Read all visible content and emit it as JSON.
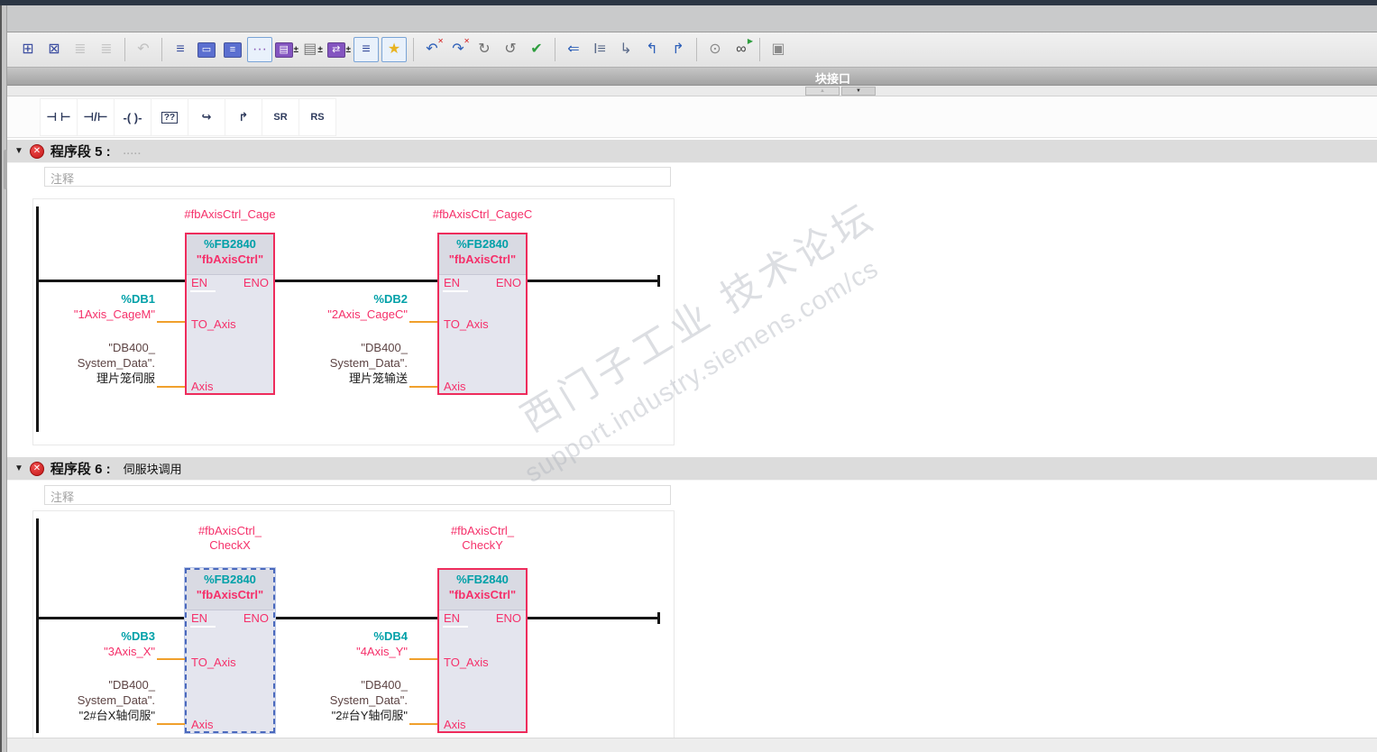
{
  "block_interface": {
    "title": "块接口",
    "collapse_up": "▲",
    "collapse_down": "▼"
  },
  "toolbar": {
    "icons": [
      {
        "name": "insert-network",
        "glyph": "⊞",
        "color": "#3b4da0"
      },
      {
        "name": "delete-network",
        "glyph": "⊠",
        "color": "#3b4da0"
      },
      {
        "name": "insert-row-above",
        "glyph": "≣",
        "color": "#9a9a9a",
        "disabled": true
      },
      {
        "name": "insert-row-below",
        "glyph": "≣",
        "color": "#9a9a9a",
        "disabled": true
      },
      {
        "sep": true
      },
      {
        "name": "keep-actual-values",
        "glyph": "↶",
        "color": "#8f8f8f",
        "disabled": true
      },
      {
        "sep": true
      },
      {
        "name": "absolute-symbolic-operands",
        "glyph": "≡",
        "color": "#3a4f9e"
      },
      {
        "name": "network-title-display",
        "glyph": "▭",
        "color": "#ffffff",
        "tile": "#5b6fd0"
      },
      {
        "name": "network-comment-display",
        "glyph": "≡",
        "color": "#ffffff",
        "tile": "#5b6fd0"
      },
      {
        "name": "toggle-comments",
        "glyph": "···",
        "color": "#8b5bb8",
        "active": true
      },
      {
        "name": "box-parameter-display",
        "glyph": "▤",
        "color": "#ffffff",
        "tile": "#8455c0",
        "dropdown": true
      },
      {
        "name": "hidden-parameter-display",
        "glyph": "▤",
        "color": "#777777",
        "dropdown": true
      },
      {
        "name": "symbol-information",
        "glyph": "⇄",
        "color": "#ffffff",
        "tile": "#8455c0",
        "dropdown": true
      },
      {
        "name": "display-format",
        "glyph": "≡",
        "color": "#3a4f9e",
        "active": true
      },
      {
        "name": "favorites-display",
        "glyph": "★",
        "color": "#e8b321",
        "active": true
      },
      {
        "sep": true
      },
      {
        "name": "previous-error",
        "glyph": "↶",
        "color": "#2d5fb8",
        "badge": "✕",
        "badge_color": "#d42020"
      },
      {
        "name": "next-error",
        "glyph": "↷",
        "color": "#2d5fb8",
        "badge": "✕",
        "badge_color": "#d42020"
      },
      {
        "name": "update-block-call",
        "glyph": "↻",
        "color": "#6f6f6f"
      },
      {
        "name": "update-interface",
        "glyph": "↺",
        "color": "#6f6f6f"
      },
      {
        "name": "consistency-check",
        "glyph": "✔",
        "color": "#2f9e3f"
      },
      {
        "sep": true
      },
      {
        "name": "call-structure",
        "glyph": "⇐",
        "color": "#2d5fb8"
      },
      {
        "name": "call-environment",
        "glyph": "I≡",
        "color": "#5b6b8a"
      },
      {
        "name": "assignment-list",
        "glyph": "↳",
        "color": "#5b6b8a"
      },
      {
        "name": "previous-marker",
        "glyph": "↰",
        "color": "#2d5fb8"
      },
      {
        "name": "next-marker",
        "glyph": "↱",
        "color": "#2d5fb8"
      },
      {
        "sep": true
      },
      {
        "name": "find-in-block",
        "glyph": "⊙",
        "color": "#8a8a8a"
      },
      {
        "name": "test-monitor",
        "glyph": "∞",
        "color": "#444444",
        "badge": "▶",
        "badge_color": "#2f9e3f"
      },
      {
        "sep": true
      },
      {
        "name": "data-block-values",
        "glyph": "▣",
        "color": "#8a8a8a"
      }
    ]
  },
  "favorites": {
    "items": [
      {
        "name": "contact-no",
        "glyph": "⊣ ⊢"
      },
      {
        "name": "contact-nc",
        "glyph": "⊣/⊢"
      },
      {
        "name": "coil",
        "glyph": "-( )-"
      },
      {
        "name": "empty-box",
        "glyph": "??",
        "boxed": true
      },
      {
        "name": "open-branch",
        "glyph": "↪"
      },
      {
        "name": "close-branch",
        "glyph": "↱"
      },
      {
        "name": "sr-flipflop",
        "glyph": "SR",
        "small": true
      },
      {
        "name": "rs-flipflop",
        "glyph": "RS",
        "small": true
      }
    ]
  },
  "networks": [
    {
      "toggle": "▼",
      "error_mark": "✕",
      "label": "程序段 5 :",
      "title": ".....",
      "comment_placeholder": "注释",
      "blocks": [
        {
          "inst1": "#fbAxisCtrl_Cage",
          "inst2": "",
          "fb_number": "%FB2840",
          "fb_name": "\"fbAxisCtrl\"",
          "pins": {
            "en": "EN",
            "eno": "ENO",
            "to_axis": "TO_Axis",
            "axis": "Axis"
          },
          "to_axis": {
            "db": "%DB1",
            "name": "\"1Axis_CageM\""
          },
          "axis": {
            "l1": "\"DB400_",
            "l2": "System_Data\".",
            "l3": "理片笼伺服"
          }
        },
        {
          "inst1": "#fbAxisCtrl_CageC",
          "inst2": "",
          "fb_number": "%FB2840",
          "fb_name": "\"fbAxisCtrl\"",
          "pins": {
            "en": "EN",
            "eno": "ENO",
            "to_axis": "TO_Axis",
            "axis": "Axis"
          },
          "to_axis": {
            "db": "%DB2",
            "name": "\"2Axis_CageC\""
          },
          "axis": {
            "l1": "\"DB400_",
            "l2": "System_Data\".",
            "l3": "理片笼输送"
          }
        }
      ]
    },
    {
      "toggle": "▼",
      "error_mark": "✕",
      "label": "程序段 6 :",
      "title": "伺服块调用",
      "comment_placeholder": "注释",
      "blocks": [
        {
          "inst1": "#fbAxisCtrl_",
          "inst2": "CheckX",
          "fb_number": "%FB2840",
          "fb_name": "\"fbAxisCtrl\"",
          "pins": {
            "en": "EN",
            "eno": "ENO",
            "to_axis": "TO_Axis",
            "axis": "Axis"
          },
          "to_axis": {
            "db": "%DB3",
            "name": "\"3Axis_X\""
          },
          "axis": {
            "l1": "\"DB400_",
            "l2": "System_Data\".",
            "l3": "\"2#台X轴伺服\""
          },
          "selected": true
        },
        {
          "inst1": "#fbAxisCtrl_",
          "inst2": "CheckY",
          "fb_number": "%FB2840",
          "fb_name": "\"fbAxisCtrl\"",
          "pins": {
            "en": "EN",
            "eno": "ENO",
            "to_axis": "TO_Axis",
            "axis": "Axis"
          },
          "to_axis": {
            "db": "%DB4",
            "name": "\"4Axis_Y\""
          },
          "axis": {
            "l1": "\"DB400_",
            "l2": "System_Data\".",
            "l3": "\"2#台Y轴伺服\""
          }
        }
      ]
    }
  ],
  "watermark": {
    "line1": "西门子工业  技术论坛",
    "line2": "support.industry.siemens.com/cs"
  },
  "colors": {
    "block_border": "#ee2c5c",
    "selected_border": "#4a69bd",
    "teal": "#00a0a8",
    "pink": "#f5306a",
    "wire_orange": "#f0a02c"
  }
}
